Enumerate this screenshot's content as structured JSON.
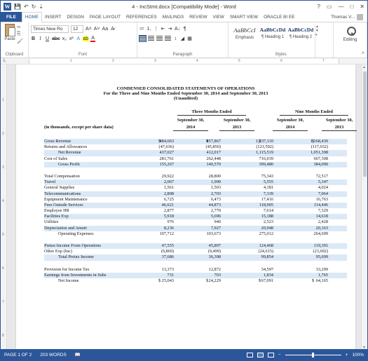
{
  "window": {
    "title": "4 - IncStmt.docx [Compatibility Mode] - Word",
    "controls": [
      "?",
      "▭",
      "—",
      "□",
      "✕"
    ]
  },
  "qat": {
    "save": "💾",
    "undo": "↶",
    "redo": "↻",
    "customize": "⇣"
  },
  "tabs": [
    "FILE",
    "HOME",
    "INSERT",
    "DESIGN",
    "PAGE LAYOUT",
    "REFERENCES",
    "MAILINGS",
    "REVIEW",
    "VIEW",
    "SMART VIEW",
    "ORACLE BI EE"
  ],
  "active_tab": "HOME",
  "user": {
    "name": "Thomas V..."
  },
  "ribbon": {
    "clipboard": {
      "label": "Clipboard",
      "paste": "Paste",
      "cut": "✂",
      "copy": "⎘",
      "format_painter": "🖌"
    },
    "font": {
      "label": "Font",
      "family": "Times New Ro",
      "size": "12",
      "grow": "A˄",
      "shrink": "A˅",
      "case": "Aa",
      "clear": "A̷",
      "bold": "B",
      "italic": "I",
      "underline": "U",
      "strike": "abc",
      "subscript": "x₂",
      "superscript": "x²",
      "effects": "A",
      "highlight": "ab",
      "color": "A"
    },
    "paragraph": {
      "label": "Paragraph",
      "bullets": "≔",
      "numbering": "⒈",
      "multilevel": "⋮",
      "dec_indent": "⇤",
      "inc_indent": "⇥",
      "sort": "A↓",
      "marks": "¶",
      "shading": "◢",
      "borders": "▦",
      "spacing": "↕"
    },
    "styles": {
      "label": "Styles",
      "items": [
        {
          "preview": "AaBbCcI",
          "name": "Emphasis"
        },
        {
          "preview": "AaBbCcDd",
          "name": "¶ Heading 1"
        },
        {
          "preview": "AaBbCcDd",
          "name": "¶ Heading 2"
        }
      ]
    },
    "editing": {
      "label": "Editing"
    }
  },
  "ruler": {
    "numbers": [
      "1",
      "2",
      "3",
      "4",
      "5",
      "6",
      "7"
    ]
  },
  "vruler": {
    "numbers": [
      "1",
      "2",
      "3",
      "4",
      "5",
      "6",
      "7",
      "8"
    ]
  },
  "report": {
    "title": "CONDENSED CONSOLIDATED STATEMENTS OF OPERATIONS",
    "subtitle": "For the Three and Nine Months Ended September 30, 2014 and September 30, 2013",
    "note": "(Unaudited)",
    "group_headers": [
      "Three Months Ended",
      "Nine Months Ended"
    ],
    "col_headers": [
      [
        "September 30,",
        "2014"
      ],
      [
        "September 30,",
        "2013"
      ],
      [
        "September 30,",
        "2014"
      ],
      [
        "September 30,",
        "2013"
      ]
    ],
    "units_label": "(in thousands, except per share data)",
    "rows": [
      {
        "label": "Gross Revenue",
        "values": [
          "484,663",
          "457,867",
          "1,237,110",
          "1,168,430"
        ],
        "dollar": [
          true,
          true,
          true,
          true
        ],
        "tint": true
      },
      {
        "label": "Returns and Allowances",
        "values": [
          "(47,636)",
          "(45,850)",
          "(121,592)",
          "(117,032)"
        ]
      },
      {
        "label": "Net Revenue",
        "values": [
          "437,027",
          "412,017",
          "1,115,519",
          "1,051,398"
        ],
        "indent": true,
        "tint": true
      },
      {
        "label": "Cost of Sales",
        "values": [
          "281,761",
          "262,448",
          "716,039",
          "667,308"
        ]
      },
      {
        "label": "Gross Profit",
        "values": [
          "155,267",
          "149,570",
          "399,480",
          "384,090"
        ],
        "indent": true,
        "tint": true
      },
      {
        "spacer": true
      },
      {
        "label": "Total Compensation",
        "values": [
          "29,922",
          "28,800",
          "75,343",
          "72,517"
        ]
      },
      {
        "label": "Travel",
        "values": [
          "2,067",
          "1,990",
          "5,555",
          "5,347"
        ],
        "tint": true
      },
      {
        "label": "General Supplies",
        "values": [
          "1,561",
          "1,503",
          "4,181",
          "4,024"
        ]
      },
      {
        "label": "Telecommunications",
        "values": [
          "2,808",
          "2,703",
          "7,339",
          "7,064"
        ],
        "tint": true
      },
      {
        "label": "Equipment Maintenance",
        "values": [
          "6,725",
          "6,473",
          "17,416",
          "16,763"
        ]
      },
      {
        "label": "Fees Outside Services",
        "values": [
          "46,621",
          "44,873",
          "118,905",
          "114,446"
        ],
        "tint": true
      },
      {
        "label": "Employee HR",
        "values": [
          "2,877",
          "2,770",
          "7,614",
          "7,329"
        ]
      },
      {
        "label": "Facilities Exp",
        "values": [
          "5,918",
          "5,696",
          "15,188",
          "14,618"
        ],
        "tint": true
      },
      {
        "label": "Utilities",
        "values": [
          "976",
          "940",
          "2,523",
          "2,428"
        ]
      },
      {
        "label": "Depreciation and Amort",
        "values": [
          "8,236",
          "7,927",
          "20,948",
          "20,163"
        ],
        "tint": true
      },
      {
        "label": "Operating Expenses",
        "values": [
          "107,712",
          "103,673",
          "275,012",
          "264,699"
        ],
        "indent": true
      },
      {
        "spacer": true
      },
      {
        "label": "Pretax Income From Operations",
        "values": [
          "47,555",
          "45,897",
          "124,468",
          "119,391"
        ],
        "tint": true
      },
      {
        "label": "Other Exp (Inc)",
        "values": [
          "(9,869)",
          "(9,499)",
          "(24,615)",
          "(23,692)"
        ]
      },
      {
        "label": "Total Pretax Income",
        "values": [
          "37,686",
          "36,398",
          "99,854",
          "95,699"
        ],
        "indent": true,
        "tint": true
      },
      {
        "spacer": true
      },
      {
        "label": "Provision for Income Tax",
        "values": [
          "13,373",
          "12,872",
          "34,597",
          "33,299"
        ]
      },
      {
        "label": "Earnings from Investments in Subs",
        "values": [
          "731",
          "703",
          "1,834",
          "1,765"
        ],
        "tint": true
      },
      {
        "label": "Net Income",
        "values": [
          "25,043",
          "24,229",
          "67,091",
          "64,165"
        ],
        "dollar": [
          true,
          true,
          true,
          true
        ],
        "indent": true
      }
    ]
  },
  "status": {
    "page": "PAGE 1 OF 2",
    "words": "203 WORDS",
    "zoom": "100%",
    "zoom_minus": "−",
    "zoom_plus": "+",
    "proof_icon": "📖"
  },
  "colors": {
    "accent": "#2b579a",
    "row_tint": "#dbe9f7"
  }
}
